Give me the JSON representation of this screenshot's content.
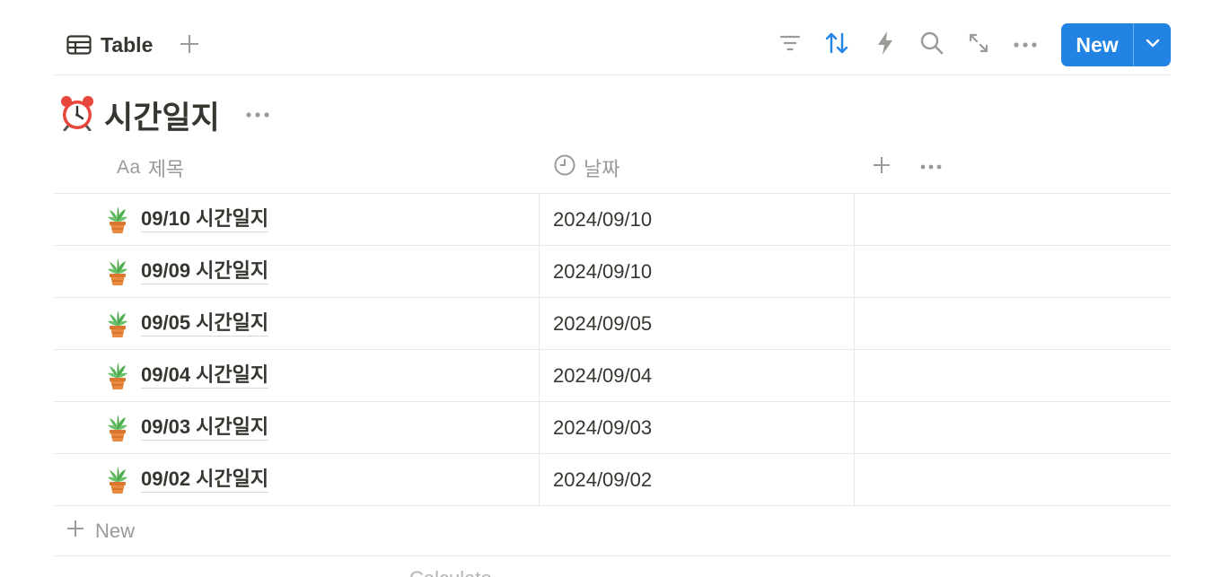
{
  "toolbar": {
    "view_tab_label": "Table",
    "view_icon": "table-icon",
    "tools": [
      {
        "name": "filter-icon",
        "color": "#9b9a97"
      },
      {
        "name": "sort-icon",
        "color": "#2383e2"
      },
      {
        "name": "automation-icon",
        "color": "#9b9a97"
      },
      {
        "name": "search-icon",
        "color": "#9b9a97"
      },
      {
        "name": "expand-icon",
        "color": "#9b9a97"
      },
      {
        "name": "more-icon",
        "color": "#9b9a97"
      }
    ],
    "new_button_label": "New",
    "accent_color": "#2383e2"
  },
  "database": {
    "title": "시간일지",
    "title_icon": "alarm-clock-icon"
  },
  "table": {
    "columns": [
      {
        "label": "제목",
        "type_icon": "text-type-icon",
        "type_label": "Aa"
      },
      {
        "label": "날짜",
        "type_icon": "clock-icon"
      }
    ],
    "rows": [
      {
        "icon": "potted-plant-icon",
        "title": "09/10 시간일지",
        "date": "2024/09/10"
      },
      {
        "icon": "potted-plant-icon",
        "title": "09/09 시간일지",
        "date": "2024/09/10"
      },
      {
        "icon": "potted-plant-icon",
        "title": "09/05 시간일지",
        "date": "2024/09/05"
      },
      {
        "icon": "potted-plant-icon",
        "title": "09/04 시간일지",
        "date": "2024/09/04"
      },
      {
        "icon": "potted-plant-icon",
        "title": "09/03 시간일지",
        "date": "2024/09/03"
      },
      {
        "icon": "potted-plant-icon",
        "title": "09/02 시간일지",
        "date": "2024/09/02"
      }
    ],
    "new_row_label": "New",
    "calculate_label": "Calculate"
  }
}
